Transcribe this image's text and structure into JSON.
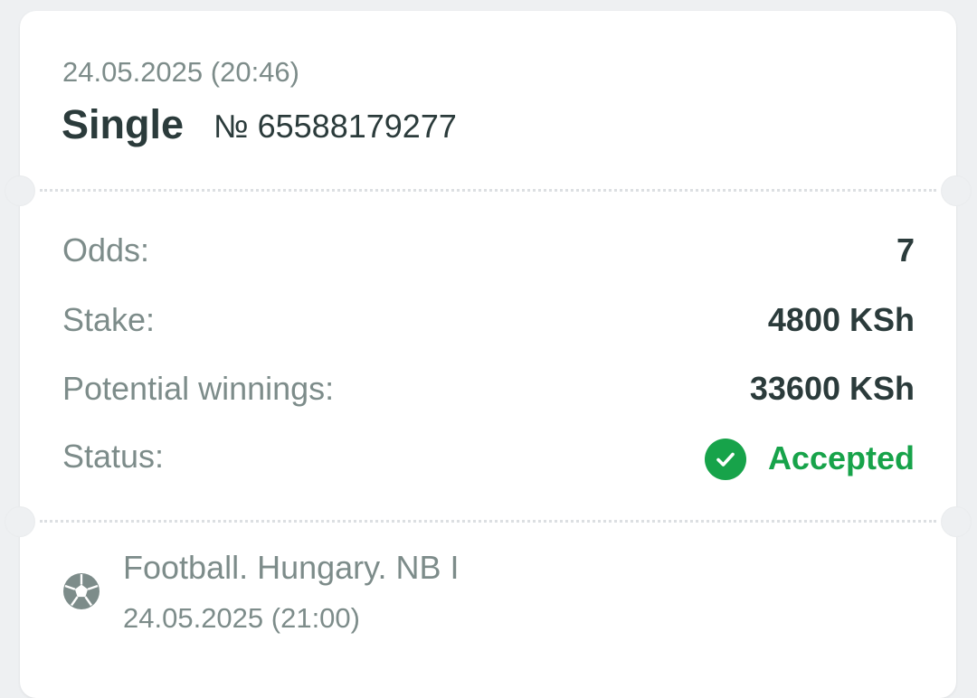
{
  "header": {
    "date": "24.05.2025 (20:46)",
    "bet_type": "Single",
    "bet_number": "№ 65588179277"
  },
  "details": {
    "odds_label": "Odds:",
    "odds_value": "7",
    "stake_label": "Stake:",
    "stake_value": "4800 KSh",
    "winnings_label": "Potential winnings:",
    "winnings_value": "33600 KSh",
    "status_label": "Status:",
    "status_value": "Accepted",
    "status_icon": "check-circle-icon",
    "status_color": "#17a34a"
  },
  "event": {
    "icon": "football-icon",
    "title": "Football. Hungary. NB I",
    "date": "24.05.2025 (21:00)"
  }
}
